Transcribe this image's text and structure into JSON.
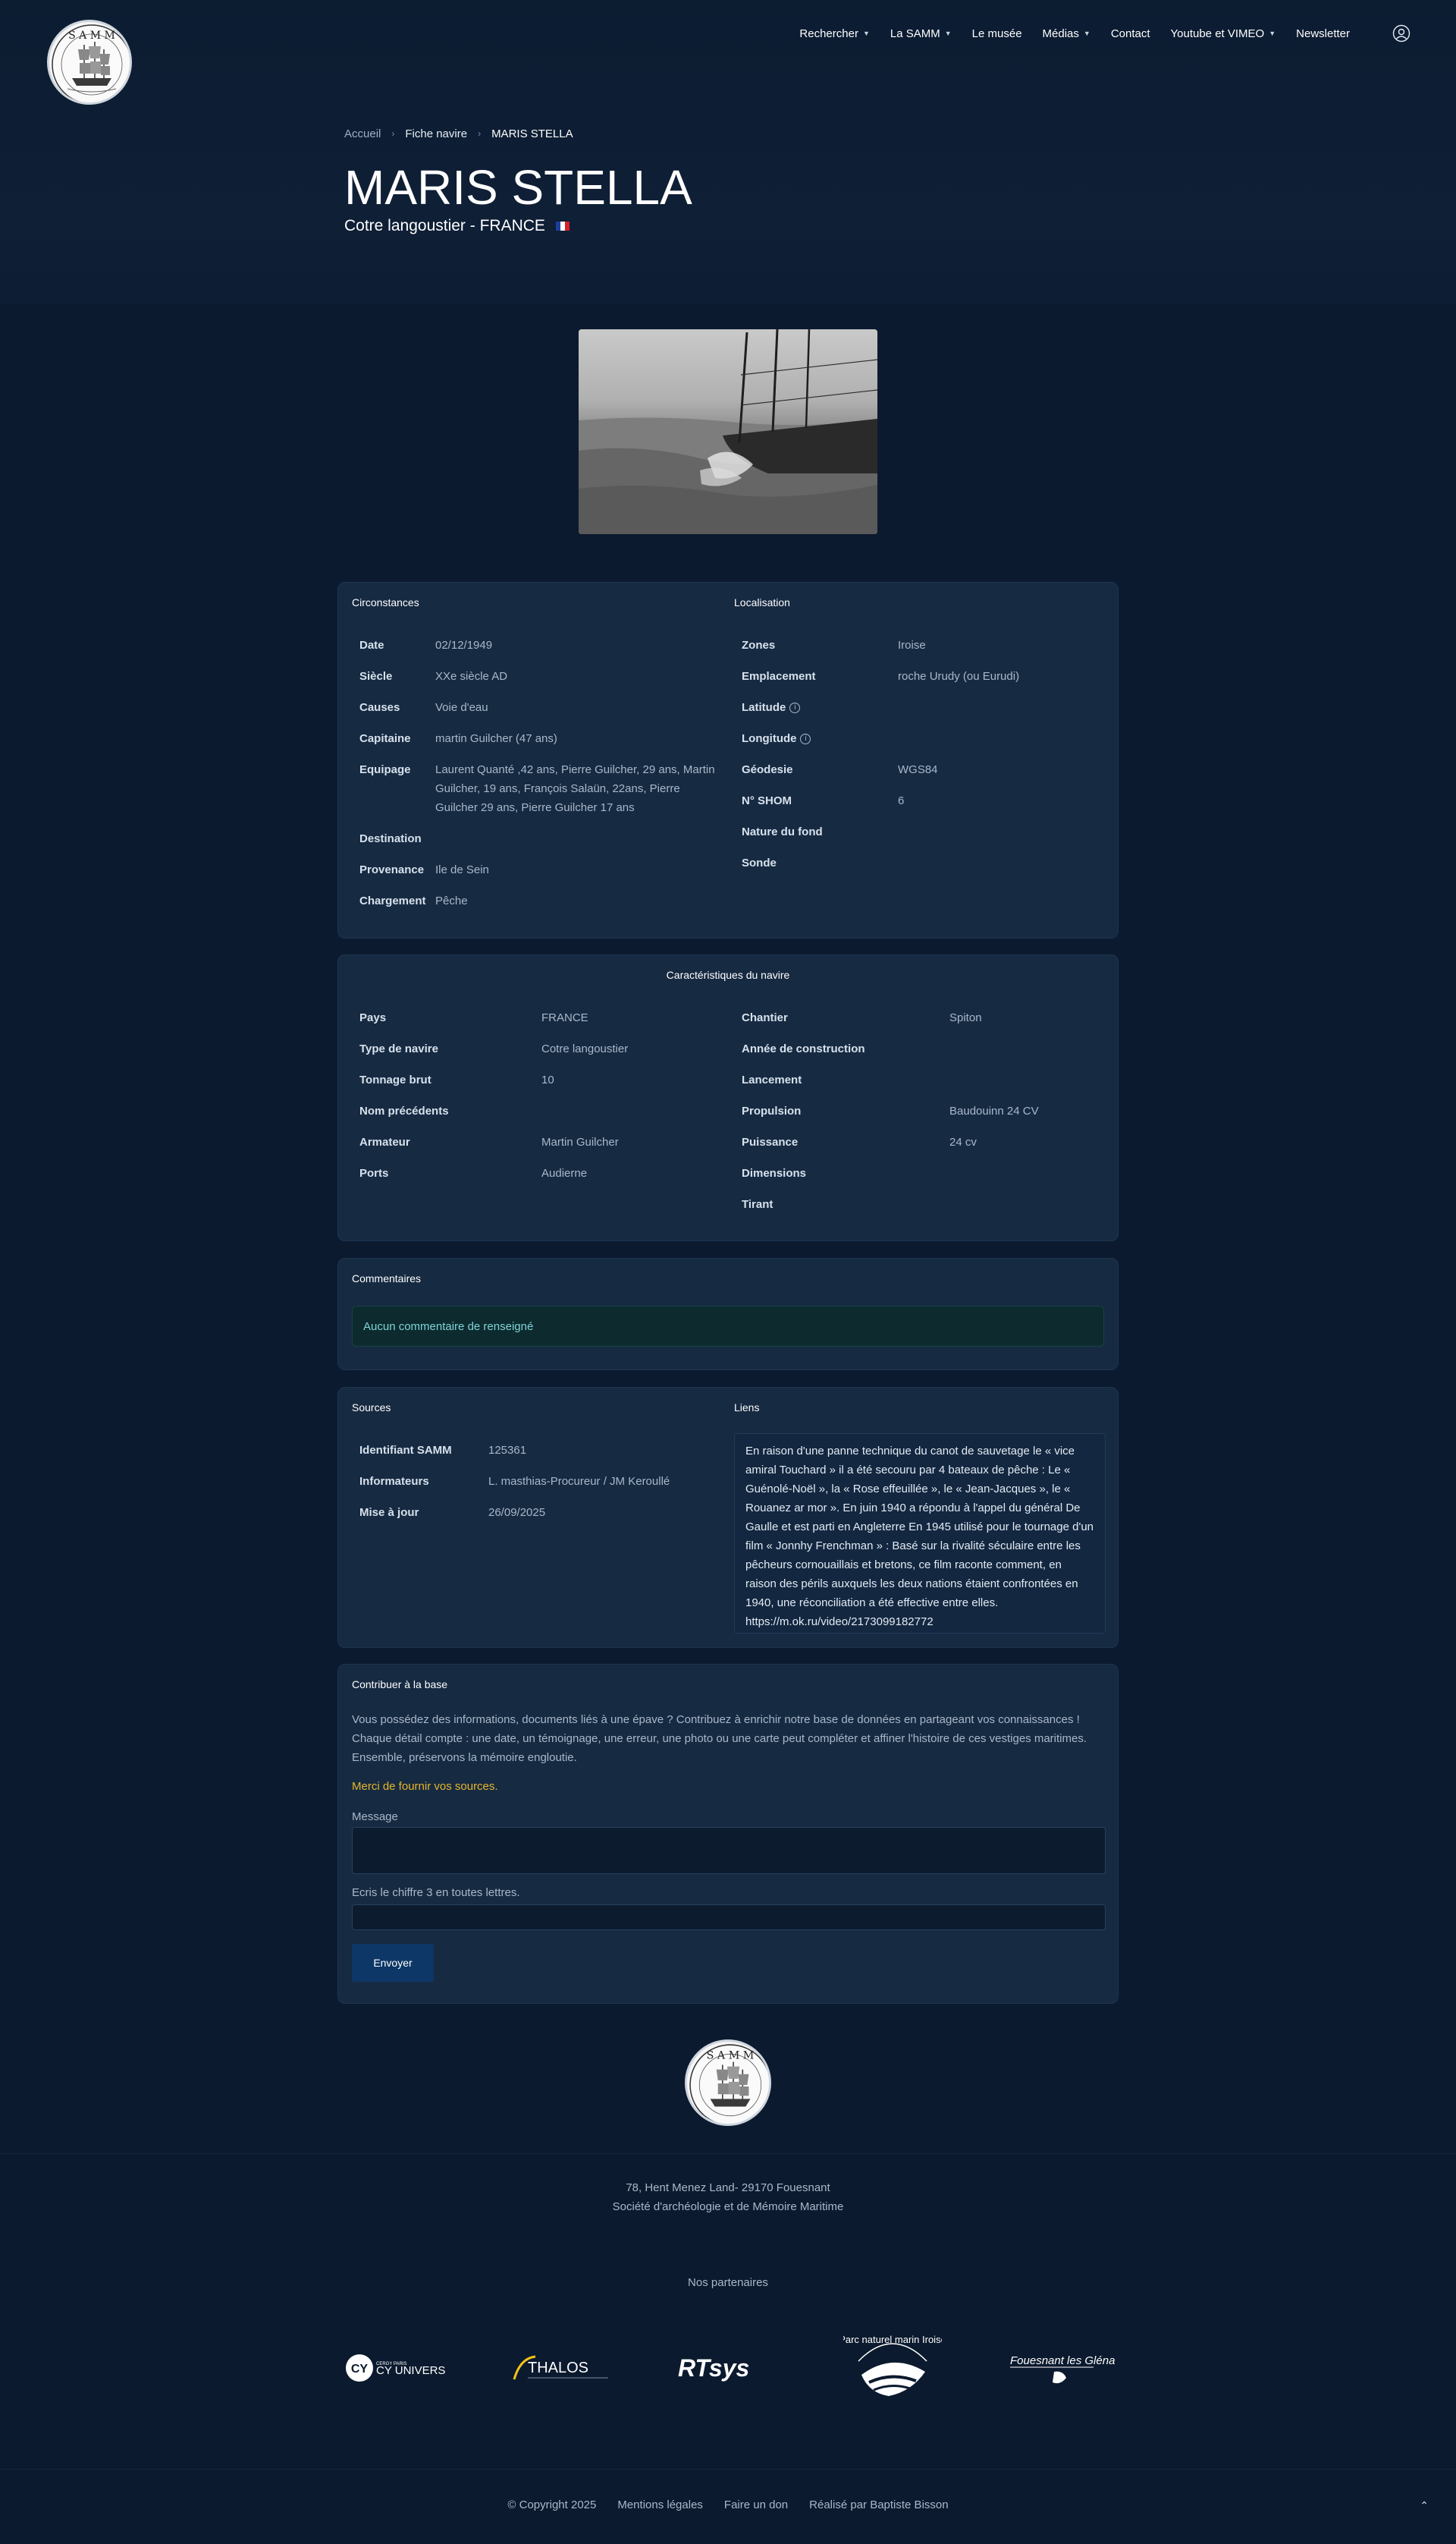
{
  "nav": {
    "items": [
      {
        "label": "Rechercher",
        "dropdown": true
      },
      {
        "label": "La SAMM",
        "dropdown": true
      },
      {
        "label": "Le musée",
        "dropdown": false
      },
      {
        "label": "Médias",
        "dropdown": true
      },
      {
        "label": "Contact",
        "dropdown": false
      },
      {
        "label": "Youtube et VIMEO",
        "dropdown": true
      },
      {
        "label": "Newsletter",
        "dropdown": false
      }
    ]
  },
  "breadcrumb": {
    "home": "Accueil",
    "sep": "›",
    "mid": "Fiche navire",
    "current": "MARIS STELLA"
  },
  "ship": {
    "name": "MARIS STELLA",
    "subtitle": "Cotre langoustier - FRANCE"
  },
  "circonstances": {
    "title": "Circonstances",
    "rows": [
      {
        "label": "Date",
        "value": "02/12/1949"
      },
      {
        "label": "Siècle",
        "value": "XXe siècle AD"
      },
      {
        "label": "Causes",
        "value": "Voie d'eau"
      },
      {
        "label": "Capitaine",
        "value": "martin Guilcher (47 ans)"
      },
      {
        "label": "Equipage",
        "value": "Laurent Quanté ,42 ans, Pierre Guilcher, 29 ans, Martin Guilcher, 19 ans, François Salaün, 22ans, Pierre Guilcher 29 ans, Pierre Guilcher 17 ans"
      },
      {
        "label": "Destination",
        "value": ""
      },
      {
        "label": "Provenance",
        "value": "Ile de Sein"
      },
      {
        "label": "Chargement",
        "value": "Pêche"
      }
    ]
  },
  "localisation": {
    "title": "Localisation",
    "rows": [
      {
        "label": "Zones",
        "value": "Iroise",
        "info": false
      },
      {
        "label": "Emplacement",
        "value": "roche Urudy (ou Eurudi)",
        "info": false
      },
      {
        "label": "Latitude",
        "value": "",
        "info": true
      },
      {
        "label": "Longitude",
        "value": "",
        "info": true
      },
      {
        "label": "Géodesie",
        "value": "WGS84",
        "info": false
      },
      {
        "label": "N° SHOM",
        "value": "6",
        "info": false
      },
      {
        "label": "Nature du fond",
        "value": "",
        "info": false
      },
      {
        "label": "Sonde",
        "value": "",
        "info": false
      }
    ]
  },
  "caracteristiques": {
    "title": "Caractéristiques du navire",
    "left": [
      {
        "label": "Pays",
        "value": "FRANCE"
      },
      {
        "label": "Type de navire",
        "value": "Cotre langoustier"
      },
      {
        "label": "Tonnage brut",
        "value": "10"
      },
      {
        "label": "Nom précédents",
        "value": ""
      },
      {
        "label": "Armateur",
        "value": "Martin Guilcher"
      },
      {
        "label": "Ports",
        "value": "Audierne"
      }
    ],
    "right": [
      {
        "label": "Chantier",
        "value": "Spiton"
      },
      {
        "label": "Année de construction",
        "value": ""
      },
      {
        "label": "Lancement",
        "value": ""
      },
      {
        "label": "Propulsion",
        "value": "Baudouinn 24 CV"
      },
      {
        "label": "Puissance",
        "value": "24 cv"
      },
      {
        "label": "Dimensions",
        "value": ""
      },
      {
        "label": "Tirant",
        "value": ""
      }
    ]
  },
  "commentaires": {
    "title": "Commentaires",
    "empty": "Aucun commentaire de renseigné"
  },
  "sources": {
    "title": "Sources",
    "rows": [
      {
        "label": "Identifiant SAMM",
        "value": "125361"
      },
      {
        "label": "Informateurs",
        "value": "L. masthias-Procureur / JM Keroullé"
      },
      {
        "label": "Mise à jour",
        "value": "26/09/2025"
      }
    ]
  },
  "liens": {
    "title": "Liens",
    "text": "En raison d'une panne technique du canot de sauvetage le « vice amiral Touchard » il a été secouru par 4 bateaux de pêche : Le « Guénolé-Noël », la « Rose effeuillée », le « Jean-Jacques », le « Rouanez ar mor ». En juin 1940 a répondu à l'appel du général De Gaulle et est parti en Angleterre En 1945 utilisé pour le tournage d'un film « Jonnhy Frenchman » : Basé sur la rivalité séculaire entre les pêcheurs cornouaillais et bretons, ce film raconte comment, en raison des périls auxquels les deux nations étaient confrontées en 1940, une réconciliation a été effective entre elles. https://m.ok.ru/video/2173099182772"
  },
  "contribuer": {
    "title": "Contribuer à la base",
    "intro": "Vous possédez des informations, documents liés à une épave  ? Contribuez à enrichir notre base de données en partageant vos connaissances ! Chaque détail compte : une date, un témoignage, une erreur, une photo ou une carte peut compléter et affiner l'histoire de ces vestiges maritimes. Ensemble, préservons la mémoire engloutie.",
    "thanks": "Merci de fournir vos sources.",
    "message_label": "Message",
    "captcha_label": "Ecris le chiffre 3 en toutes lettres.",
    "submit": "Envoyer"
  },
  "footer": {
    "address": "78, Hent Menez Land- 29170 Fouesnant",
    "org": "Société d'archéologie et de Mémoire Maritime",
    "partners_title": "Nos partenaires",
    "partners": [
      "CY UNIVERSITÉ",
      "THALOS",
      "RTsys",
      "Parc naturel marin Iroise",
      "Fouesnant les Glénan"
    ],
    "links": [
      "© Copyright 2025",
      "Mentions légales",
      "Faire un don",
      "Réalisé par Baptiste Bisson"
    ]
  },
  "colors": {
    "background": "#0b1a2e",
    "card": "#162a42",
    "accent_yellow": "#e7b62b",
    "button": "#0d3766"
  }
}
